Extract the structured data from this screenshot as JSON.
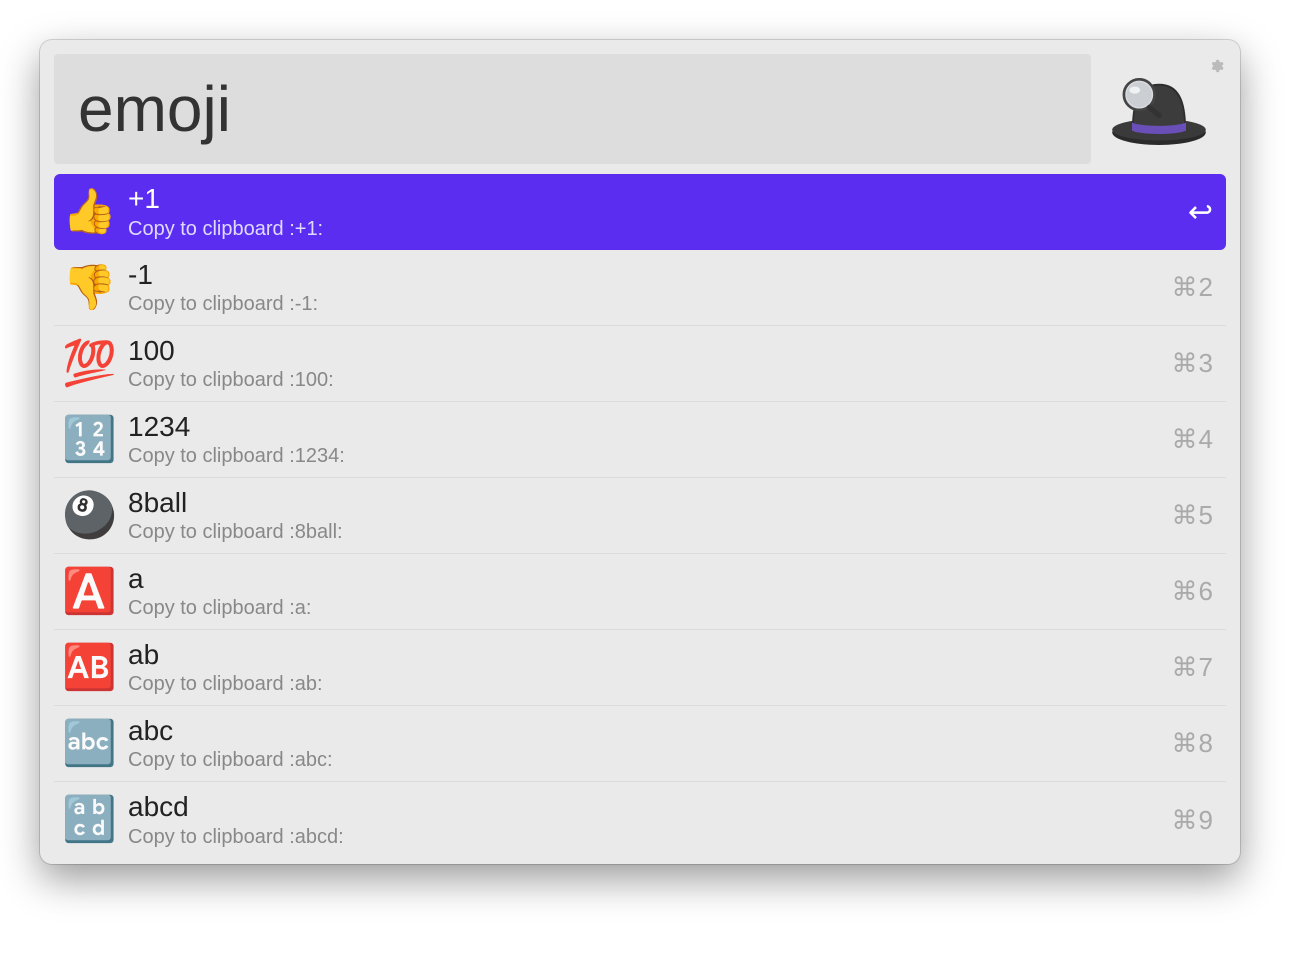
{
  "search": {
    "value": "emoji"
  },
  "results": [
    {
      "icon": "👍",
      "title": "+1",
      "subtitle": "Copy to clipboard :+1:",
      "shortcut": "↩",
      "selected": true
    },
    {
      "icon": "👎",
      "title": "-1",
      "subtitle": "Copy to clipboard :-1:",
      "shortcut": "⌘2",
      "selected": false
    },
    {
      "icon": "💯",
      "title": "100",
      "subtitle": "Copy to clipboard :100:",
      "shortcut": "⌘3",
      "selected": false
    },
    {
      "icon": "🔢",
      "title": "1234",
      "subtitle": "Copy to clipboard :1234:",
      "shortcut": "⌘4",
      "selected": false
    },
    {
      "icon": "🎱",
      "title": "8ball",
      "subtitle": "Copy to clipboard :8ball:",
      "shortcut": "⌘5",
      "selected": false
    },
    {
      "icon": "🅰️",
      "title": "a",
      "subtitle": "Copy to clipboard :a:",
      "shortcut": "⌘6",
      "selected": false
    },
    {
      "icon": "🆎",
      "title": "ab",
      "subtitle": "Copy to clipboard :ab:",
      "shortcut": "⌘7",
      "selected": false
    },
    {
      "icon": "🔤",
      "title": "abc",
      "subtitle": "Copy to clipboard :abc:",
      "shortcut": "⌘8",
      "selected": false
    },
    {
      "icon": "🔡",
      "title": "abcd",
      "subtitle": "Copy to clipboard :abcd:",
      "shortcut": "⌘9",
      "selected": false
    }
  ]
}
